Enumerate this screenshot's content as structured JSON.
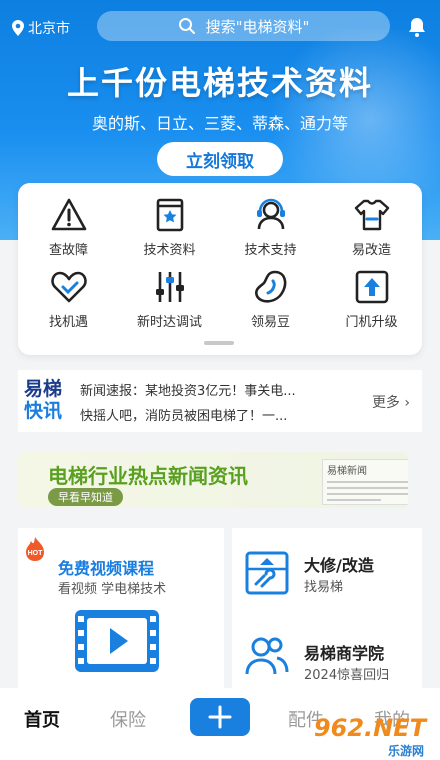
{
  "header": {
    "location": "北京市",
    "search_placeholder": "搜索\"电梯资料\""
  },
  "hero": {
    "title": "上千份电梯技术资料",
    "subtitle": "奥的斯、日立、三菱、蒂森、通力等",
    "cta": "立刻领取"
  },
  "grid": {
    "items": [
      {
        "label": "查故障",
        "icon": "warning-icon"
      },
      {
        "label": "技术资料",
        "icon": "book-icon"
      },
      {
        "label": "技术支持",
        "icon": "headset-icon"
      },
      {
        "label": "易改造",
        "icon": "shirt-icon"
      },
      {
        "label": "找机遇",
        "icon": "heart-handshake-icon"
      },
      {
        "label": "新时达调试",
        "icon": "sliders-icon"
      },
      {
        "label": "领易豆",
        "icon": "bean-icon"
      },
      {
        "label": "门机升级",
        "icon": "upload-box-icon"
      }
    ]
  },
  "news": {
    "logo_top": "易梯",
    "logo_bottom": "快讯",
    "lines": [
      "新闻速报：某地投资3亿元！事关电...",
      "快摇人吧，消防员被困电梯了！一..."
    ],
    "more": "更多"
  },
  "banner": {
    "title": "电梯行业热点新闻资讯",
    "pill": "早看早知道",
    "paper_title": "易梯新闻"
  },
  "promo_left": {
    "badge": "HOT",
    "title": "免费视频课程",
    "subtitle": "看视频 学电梯技术"
  },
  "promo_right": [
    {
      "title": "大修/改造",
      "subtitle": "找易梯"
    },
    {
      "title": "易梯商学院",
      "subtitle": "2024惊喜回归"
    }
  ],
  "tabbar": {
    "tabs": [
      "首页",
      "保险",
      "配件",
      "我的"
    ]
  },
  "watermark": {
    "text": "962.NET",
    "sub": "乐游网"
  },
  "colors": {
    "brand_blue": "#1a80e0",
    "banner_green": "#5aa020",
    "hot_orange": "#f05a28"
  }
}
